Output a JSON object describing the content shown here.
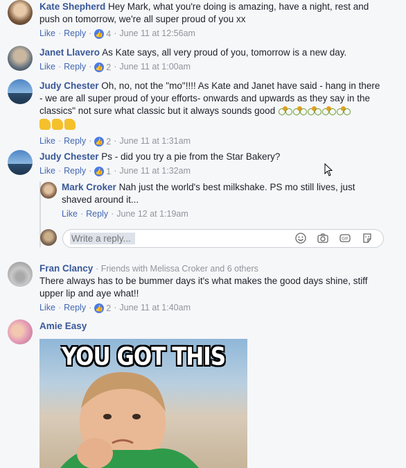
{
  "common": {
    "like": "Like",
    "reply": "Reply",
    "sep": "·"
  },
  "comments": [
    {
      "author": "Kate Shepherd",
      "text": "Hey Mark, what you're doing is amazing, have a night, rest and push on tomorrow, we're all super proud of you xx",
      "likes": "4",
      "time": "June 11 at 12:56am"
    },
    {
      "author": "Janet Llavero",
      "text": "As Kate says, all very proud of you, tomorrow is a new day.",
      "likes": "2",
      "time": "June 11 at 1:00am"
    },
    {
      "author": "Judy Chester",
      "text": "Oh, no, not the \"mo\"!!!! As Kate and Janet have said - hang in there - we are all super proud of your efforts- onwards and upwards as they say in the classics\" not sure what classic but it always sounds good",
      "likes": "2",
      "time": "June 11 at 1:31am"
    },
    {
      "author": "Judy Chester",
      "text": "Ps - did you try a pie from the Star Bakery?",
      "likes": "1",
      "time": "June 11 at 1:32am"
    },
    {
      "author": "Fran Clancy",
      "friends": "Friends with Melissa Croker and 6 others",
      "text": "There always has to be bummer days it's what makes the good days shine, stiff upper lip and aye what!!",
      "likes": "2",
      "time": "June 11 at 1:40am"
    },
    {
      "author": "Amie Easy"
    }
  ],
  "reply": {
    "author": "Mark Croker",
    "text": "Nah just the world's best milkshake. PS mo still lives, just shaved around it...",
    "time": "June 12 at 1:19am"
  },
  "reply_box": {
    "placeholder": "Write a reply..."
  },
  "meme": {
    "caption": "YOU GOT THIS"
  }
}
